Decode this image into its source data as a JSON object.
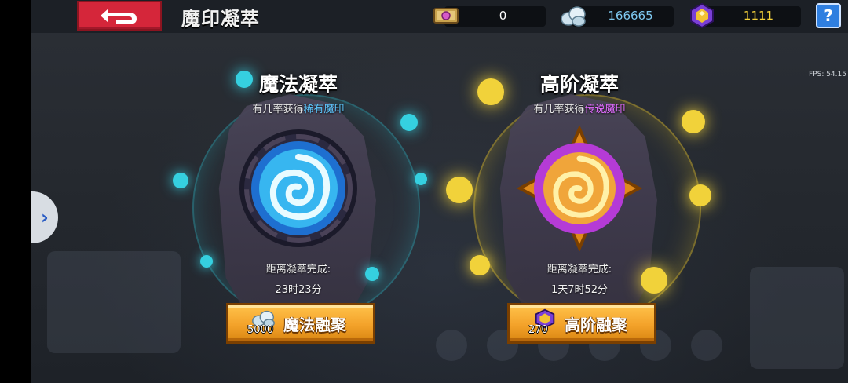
{
  "header": {
    "title": "魔印凝萃"
  },
  "currencies": [
    {
      "name": "magic-seal-ticket",
      "value": "0",
      "color": "#ffffff"
    },
    {
      "name": "silver-ore",
      "value": "166665",
      "color": "#7ec8f0"
    },
    {
      "name": "gem",
      "value": "1111",
      "color": "#f4d13a"
    }
  ],
  "help": {
    "label": "?"
  },
  "fps": "FPS: 54.15",
  "panels": [
    {
      "title": "魔法凝萃",
      "subtitle_prefix": "有几率获得",
      "subtitle_highlight": "稀有魔印",
      "highlight_color": "#5ec8ff",
      "remain_label": "距离凝萃完成:",
      "timer": "23时23分",
      "button_label": "魔法融聚",
      "cost": "5000",
      "accent": "#2ec7d8"
    },
    {
      "title": "高阶凝萃",
      "subtitle_prefix": "有几率获得",
      "subtitle_highlight": "传说魔印",
      "highlight_color": "#e26cff",
      "remain_label": "距离凝萃完成:",
      "timer": "1天7时52分",
      "button_label": "高阶融聚",
      "cost": "270",
      "accent": "#e5c22a"
    }
  ]
}
